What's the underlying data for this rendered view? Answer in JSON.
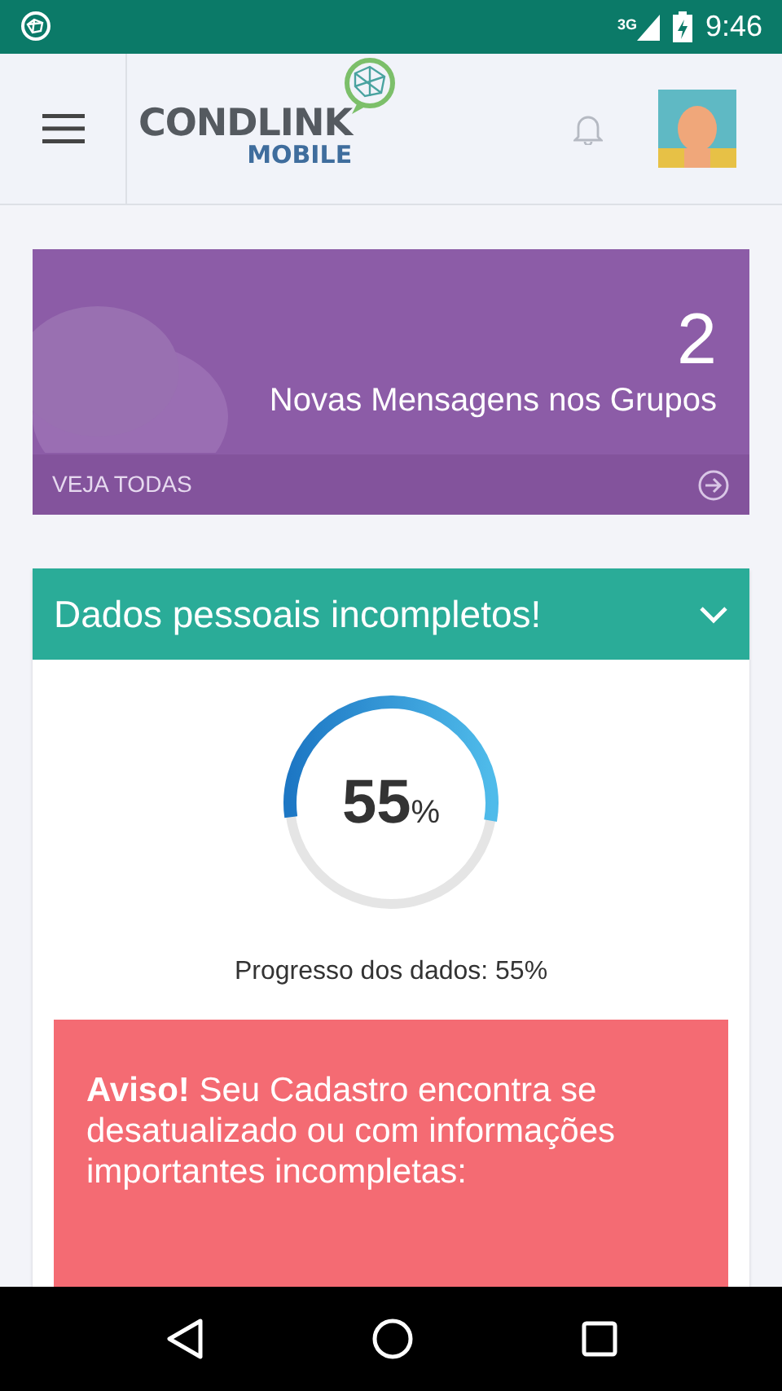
{
  "status_bar": {
    "network": "3G",
    "time": "9:46"
  },
  "app_bar": {
    "logo_text": "CONDLINK",
    "logo_subtext": "MOBILE"
  },
  "messages_card": {
    "count": "2",
    "label": "Novas Mensagens nos Grupos",
    "link": "VEJA TODAS"
  },
  "profile_card": {
    "title": "Dados pessoais incompletos!",
    "progress": {
      "value": "55",
      "unit": "%",
      "caption": "Progresso dos dados: 55%"
    },
    "alert": {
      "text": "**Aviso!** Seu Cadastro encontra se desatualizado ou com informações importantes incompletas:"
    }
  }
}
